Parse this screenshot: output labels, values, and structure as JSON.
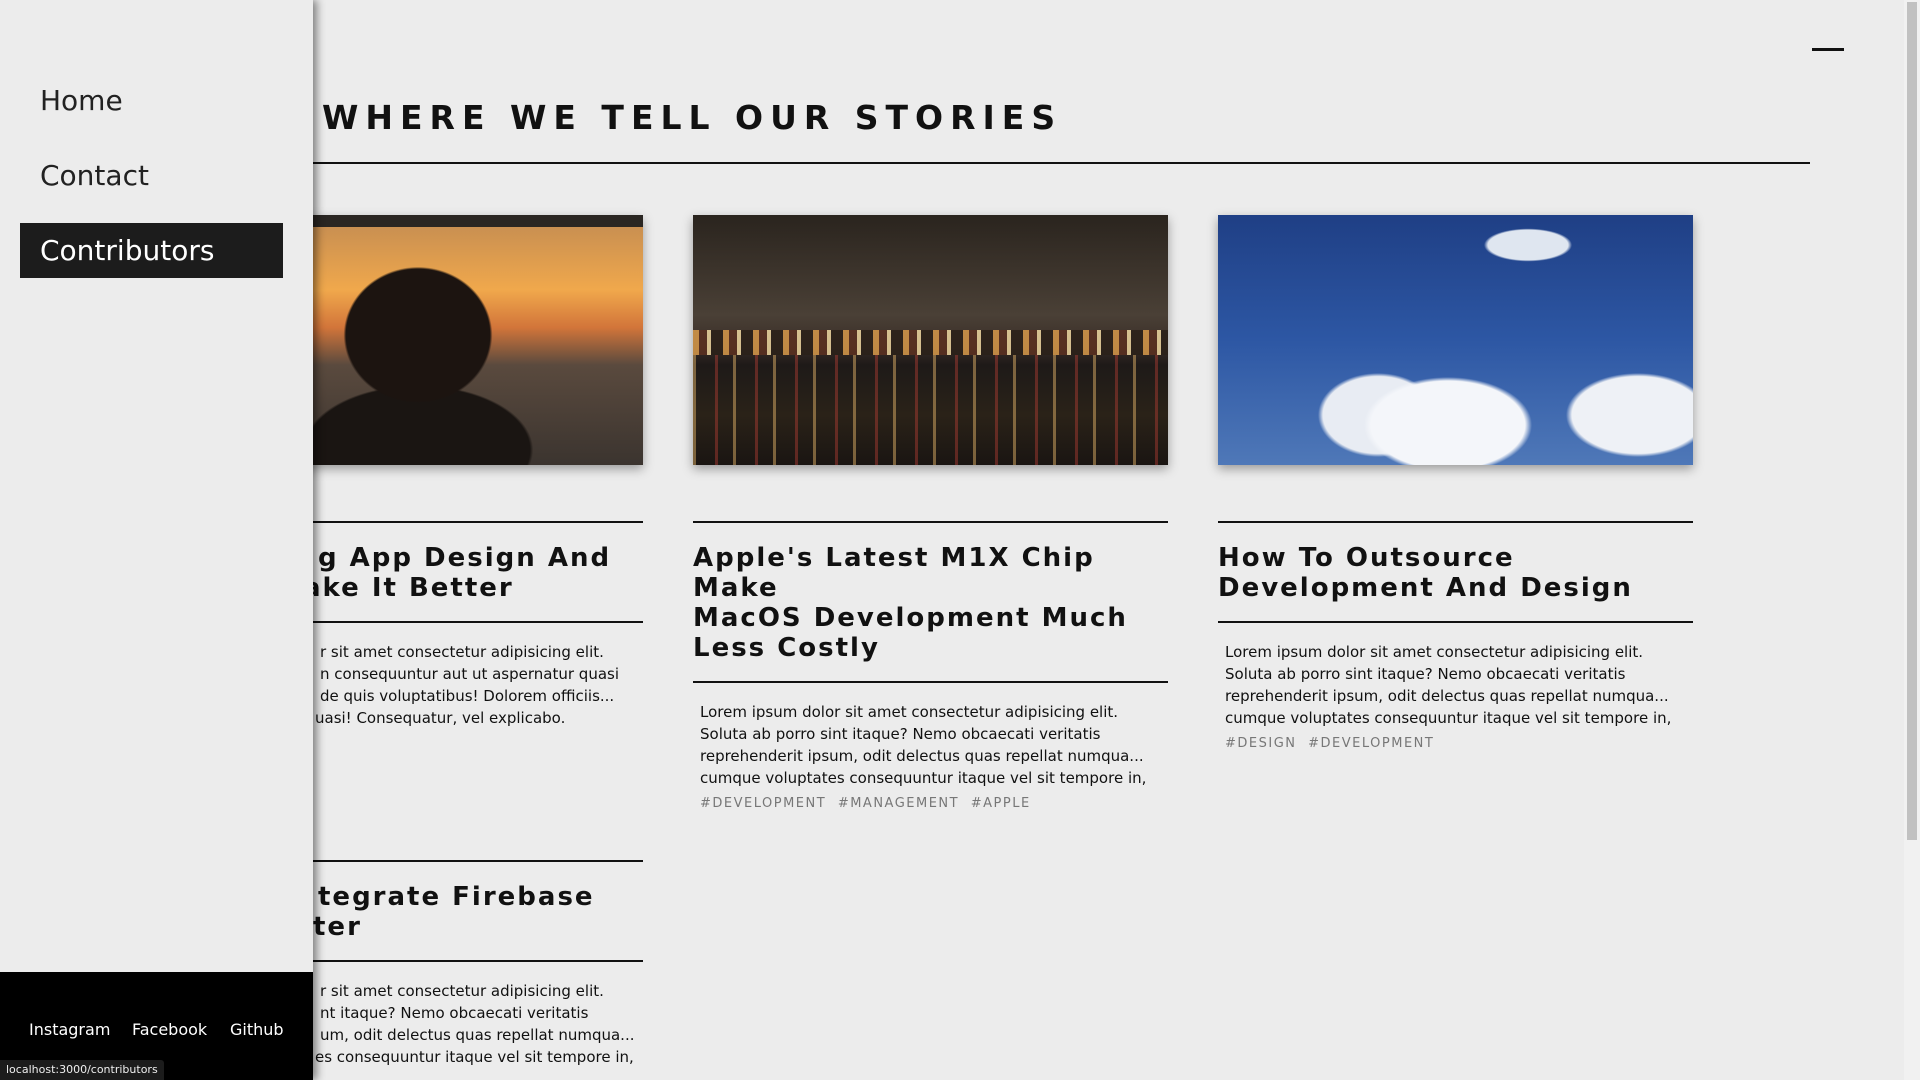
{
  "page": {
    "title": "WHERE WE TELL OUR STORIES"
  },
  "nav": {
    "items": [
      {
        "label": "Home",
        "active": false
      },
      {
        "label": "Contact",
        "active": false
      },
      {
        "label": "Contributors",
        "active": true
      }
    ],
    "active_bg": "#1c1c1c"
  },
  "footer": {
    "links": [
      "Instagram",
      "Facebook",
      "Github"
    ]
  },
  "status_bar": {
    "url": "localhost:3000/contributors"
  },
  "posts": [
    {
      "image": "pilot-cockpit-sunset",
      "title": "g App Design And ake It Better",
      "title_lines": [
        "g App Design And",
        "ake It Better"
      ],
      "excerpt_lines": [
        "r sit amet consectetur adipisicing elit.",
        "n consequuntur aut ut aspernatur quasi",
        "de quis voluptatibus! Dolorem officiis...",
        "uasi! Consequatur, vel explicabo. Tempora,"
      ],
      "tags": []
    },
    {
      "image": "city-river-night",
      "title_lines": [
        "Apple's Latest M1X Chip Make",
        "MacOS Development Much",
        "Less Costly"
      ],
      "excerpt_lines": [
        "Lorem ipsum dolor sit amet consectetur adipisicing elit.",
        "Soluta ab porro sint itaque? Nemo obcaecati veritatis",
        "reprehenderit ipsum, odit delectus quas repellat numqua...",
        "cumque voluptates consequuntur itaque vel sit tempore in,"
      ],
      "tags": [
        "#DEVELOPMENT",
        "#MANAGEMENT",
        "#APPLE"
      ]
    },
    {
      "image": "blue-sky-clouds",
      "title_lines": [
        "How To Outsource",
        "Development And Design"
      ],
      "excerpt_lines": [
        "Lorem ipsum dolor sit amet consectetur adipisicing elit.",
        "Soluta ab porro sint itaque? Nemo obcaecati veritatis",
        "reprehenderit ipsum, odit delectus quas repellat numqua...",
        "cumque voluptates consequuntur itaque vel sit tempore in,"
      ],
      "tags": [
        "#DESIGN",
        "#DEVELOPMENT"
      ]
    },
    {
      "image": "",
      "title_lines": [
        "tegrate Firebase",
        "ter"
      ],
      "excerpt_lines": [
        "r sit amet consectetur adipisicing elit.",
        "nt itaque? Nemo obcaecati veritatis",
        "um, odit delectus quas repellat numqua...",
        "es consequuntur itaque vel sit tempore in,"
      ],
      "tags": []
    }
  ],
  "icons": {
    "menu": "hamburger-menu-icon"
  }
}
